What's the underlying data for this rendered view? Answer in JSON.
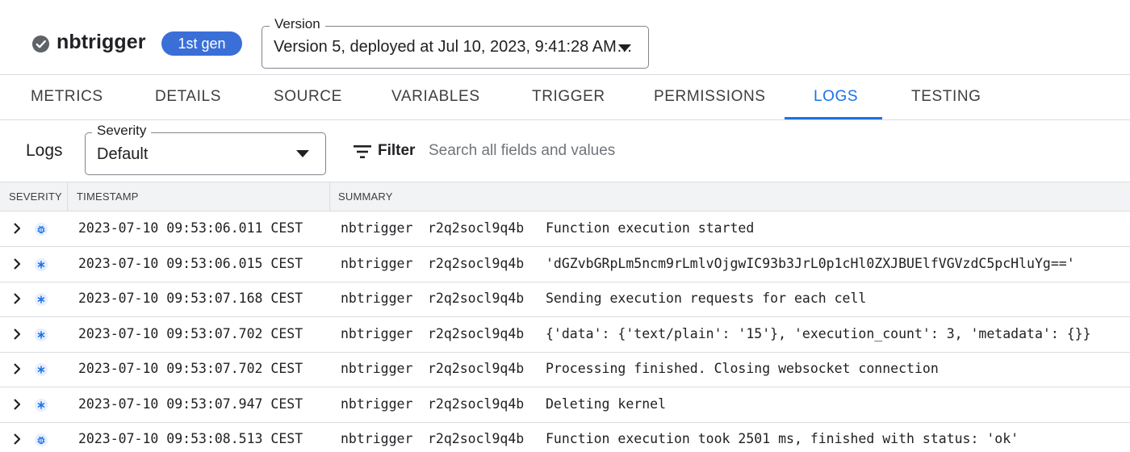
{
  "header": {
    "function_name": "nbtrigger",
    "status_icon": "check-circle-icon",
    "gen_badge": "1st gen",
    "version_label": "Version",
    "version_value": "Version 5, deployed at Jul 10, 2023, 9:41:28 AM…"
  },
  "tabs": [
    {
      "label": "METRICS",
      "active": false
    },
    {
      "label": "DETAILS",
      "active": false
    },
    {
      "label": "SOURCE",
      "active": false
    },
    {
      "label": "VARIABLES",
      "active": false
    },
    {
      "label": "TRIGGER",
      "active": false
    },
    {
      "label": "PERMISSIONS",
      "active": false
    },
    {
      "label": "LOGS",
      "active": true
    },
    {
      "label": "TESTING",
      "active": false
    }
  ],
  "logs": {
    "title": "Logs",
    "severity_label": "Severity",
    "severity_value": "Default",
    "filter_label": "Filter",
    "search_placeholder": "Search all fields and values"
  },
  "table": {
    "columns": [
      "SEVERITY",
      "TIMESTAMP",
      "SUMMARY"
    ],
    "rows": [
      {
        "severity": "debug",
        "timestamp": "2023-07-10 09:53:06.011 CEST",
        "function": "nbtrigger",
        "execution_id": "r2q2socl9q4b",
        "message": "Function execution started"
      },
      {
        "severity": "default",
        "timestamp": "2023-07-10 09:53:06.015 CEST",
        "function": "nbtrigger",
        "execution_id": "r2q2socl9q4b",
        "message": "'dGZvbGRpLm5ncm9rLmlvOjgwIC93b3JrL0p1cHl0ZXJBUElfVGVzdC5pcHluYg=='"
      },
      {
        "severity": "default",
        "timestamp": "2023-07-10 09:53:07.168 CEST",
        "function": "nbtrigger",
        "execution_id": "r2q2socl9q4b",
        "message": "Sending execution requests for each cell"
      },
      {
        "severity": "default",
        "timestamp": "2023-07-10 09:53:07.702 CEST",
        "function": "nbtrigger",
        "execution_id": "r2q2socl9q4b",
        "message": "{'data': {'text/plain': '15'}, 'execution_count': 3, 'metadata': {}}"
      },
      {
        "severity": "default",
        "timestamp": "2023-07-10 09:53:07.702 CEST",
        "function": "nbtrigger",
        "execution_id": "r2q2socl9q4b",
        "message": "Processing finished. Closing websocket connection"
      },
      {
        "severity": "default",
        "timestamp": "2023-07-10 09:53:07.947 CEST",
        "function": "nbtrigger",
        "execution_id": "r2q2socl9q4b",
        "message": "Deleting kernel"
      },
      {
        "severity": "debug",
        "timestamp": "2023-07-10 09:53:08.513 CEST",
        "function": "nbtrigger",
        "execution_id": "r2q2socl9q4b",
        "message": "Function execution took 2501 ms, finished with status: 'ok'"
      }
    ]
  },
  "colors": {
    "accent": "#1a73e8",
    "badge": "#3a6fd8",
    "severity_icon": "#1a73e8"
  }
}
